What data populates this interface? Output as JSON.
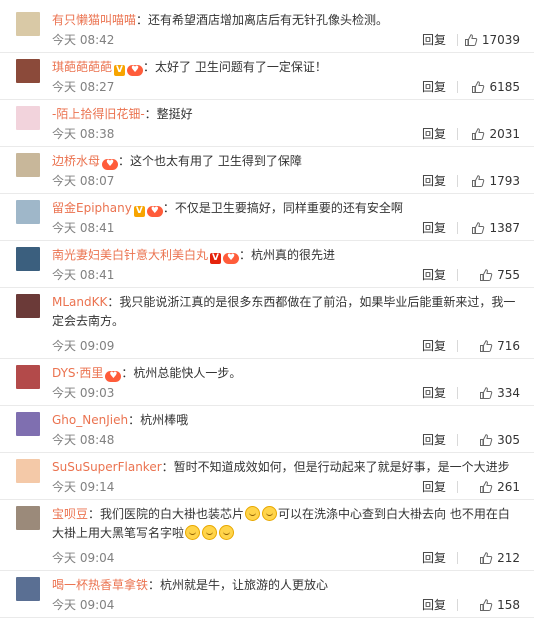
{
  "footer": {
    "reply_label": "回复"
  },
  "comments": [
    {
      "user": "有只懒猫叫喵喵",
      "badges": [],
      "text": "：还有希望酒店增加离店后有无针孔像头检测。",
      "emojis_after": 0,
      "time": "今天 08:42",
      "likes": "17039",
      "avatar_color": "#d9c9a6"
    },
    {
      "user": "琪葩葩葩葩",
      "badges": [
        "v",
        "fan"
      ],
      "text": "：太好了 卫生问题有了一定保证！",
      "emojis_after": 0,
      "time": "今天 08:27",
      "likes": "6185",
      "avatar_color": "#8b4a3a"
    },
    {
      "user": "-陌上拾得旧花钿-",
      "badges": [],
      "text": "：整挺好",
      "emojis_after": 0,
      "time": "今天 08:38",
      "likes": "2031",
      "avatar_color": "#f2d3dc"
    },
    {
      "user": "边桥水母",
      "badges": [
        "fan"
      ],
      "text": "：这个也太有用了 卫生得到了保障",
      "emojis_after": 0,
      "time": "今天 08:07",
      "likes": "1793",
      "avatar_color": "#c8b79a"
    },
    {
      "user": "留金Epiphany",
      "badges": [
        "v",
        "fan"
      ],
      "text": "：不仅是卫生要搞好，同样重要的还有安全啊",
      "emojis_after": 0,
      "time": "今天 08:41",
      "likes": "1387",
      "avatar_color": "#9fb7c9"
    },
    {
      "user": "南光妻妇美白针意大利美白丸",
      "badges": [
        "vred",
        "fan"
      ],
      "text": "：杭州真的很先进",
      "emojis_after": 0,
      "time": "今天 08:41",
      "likes": "755",
      "avatar_color": "#3b5f7e"
    },
    {
      "user": "MLandKK",
      "badges": [],
      "text": "：我只能说浙江真的是很多东西都做在了前沿，如果毕业后能重新来过，我一定会去南方。",
      "emojis_after": 0,
      "time": "今天 09:09",
      "likes": "716",
      "avatar_color": "#6b3a38"
    },
    {
      "user": "DYS·西里",
      "badges": [
        "fan"
      ],
      "text": "：杭州总能快人一步。",
      "emojis_after": 0,
      "time": "今天 09:03",
      "likes": "334",
      "avatar_color": "#b34a4a"
    },
    {
      "user": "Gho_NenJieh",
      "badges": [],
      "text": "：杭州棒哦",
      "emojis_after": 0,
      "time": "今天 08:48",
      "likes": "305",
      "avatar_color": "#7f6fb0"
    },
    {
      "user": "SuSuSuperFlanker",
      "badges": [],
      "text": "：暂时不知道成效如何，但是行动起来了就是好事，是一个大进步",
      "emojis_after": 0,
      "time": "今天 09:14",
      "likes": "261",
      "avatar_color": "#f4c9a8"
    },
    {
      "user": "宝呗豆",
      "badges": [],
      "text": "：我们医院的白大褂也装芯片",
      "text2": "可以在洗涤中心查到白大褂去向 也不用在白大褂上用大黑笔写名字啦",
      "emojis_mid": 2,
      "emojis_after": 3,
      "time": "今天 09:04",
      "likes": "212",
      "avatar_color": "#9b8a7a"
    },
    {
      "user": "喝一杯热香草拿铁",
      "badges": [],
      "text": "：杭州就是牛，让旅游的人更放心",
      "emojis_after": 0,
      "time": "今天 09:04",
      "likes": "158",
      "avatar_color": "#5a6f93"
    }
  ]
}
